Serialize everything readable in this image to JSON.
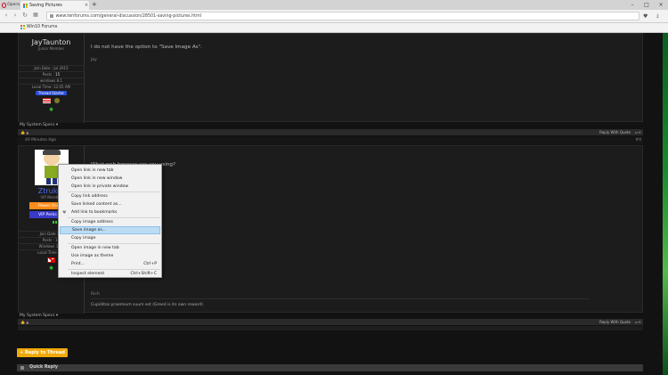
{
  "browser": {
    "menu_label": "Opera",
    "tab_title": "Saving Pictures",
    "tab_close": "×",
    "new_tab": "+",
    "window_controls": [
      "–",
      "□",
      "×"
    ],
    "url": "www.tenforums.com/general-discussion/28501-saving-pictures.html",
    "bookmark_label": "Win10 Forums",
    "icons": [
      "back-icon",
      "forward-icon",
      "reload-icon",
      "home-icon",
      "heart-icon",
      "download-icon"
    ]
  },
  "post1": {
    "username": "JayTaunton",
    "usertitle": "Junior Member",
    "join_label": "Join Date : Jul 2015",
    "posts_label": "Posts :",
    "posts_value": "15",
    "os_label": "windows 8.1",
    "localtime_label": "Local Time: 12:05 AM",
    "thread_starter": "Thread Starter",
    "message": "I do not have the option to \"Save Image As\".",
    "signature": "Jay",
    "system_specs": "My System Specs"
  },
  "post2": {
    "time_ago": "40 Minutes Ago",
    "post_number": "#4",
    "username": "Ztruker",
    "usertitle": "VIP Member",
    "power_user": "Power User",
    "vip_badge": "VIP Perks",
    "join_label": "Join Date : Ju",
    "posts_label": "Posts : 14",
    "os_label": "Windows 10 F",
    "localtime_label": "Local Time : 12",
    "message_visible": "What web browser are you using?",
    "signature": "Rich",
    "footer_quote": "Cupiditas praemium suum est (Greed is its own reward)",
    "system_specs": "My System Specs"
  },
  "actions": {
    "reply_with_quote": "Reply With Quote",
    "reply_to_thread": "+ Reply to Thread",
    "quick_reply": "Quick Reply"
  },
  "context_menu": {
    "items": [
      {
        "label": "Open link in new tab",
        "shortcut": ""
      },
      {
        "label": "Open link in new window",
        "shortcut": ""
      },
      {
        "label": "Open link in private window",
        "shortcut": ""
      },
      {
        "label": "Copy link address",
        "shortcut": ""
      },
      {
        "label": "Save linked content as...",
        "shortcut": ""
      },
      {
        "label": "Add link to bookmarks",
        "shortcut": ""
      },
      {
        "label": "Copy image address",
        "shortcut": ""
      },
      {
        "label": "Save image as...",
        "shortcut": ""
      },
      {
        "label": "Copy image",
        "shortcut": ""
      },
      {
        "label": "Open image in new tab",
        "shortcut": ""
      },
      {
        "label": "Use image as theme",
        "shortcut": ""
      },
      {
        "label": "Print...",
        "shortcut": "Ctrl+P"
      },
      {
        "label": "Inspect element",
        "shortcut": "Ctrl+Shift+C"
      }
    ],
    "highlighted_index": 7
  },
  "colors": {
    "accent_orange": "#f0a90b",
    "highlight_blue": "#bcdcf4",
    "page_bg": "#121212"
  }
}
